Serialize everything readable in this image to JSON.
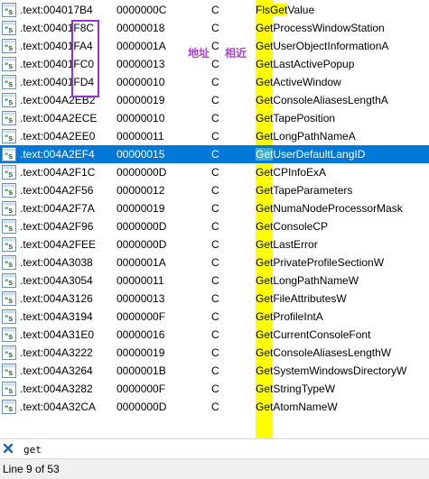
{
  "annotations": {
    "address_label": "地址",
    "similar_label": "相近",
    "box_color": "#9b30d9"
  },
  "colors": {
    "selection": "#0078d7",
    "highlight": "#ffff00",
    "selected_highlight": "#3fb0d0"
  },
  "rows": [
    {
      "address": ".text:004017B4",
      "length": "0000000C",
      "type": "C",
      "pre": "Fls",
      "match": "Get",
      "post": "Value"
    },
    {
      "address": ".text:00401F8C",
      "length": "00000018",
      "type": "C",
      "pre": "",
      "match": "Get",
      "post": "ProcessWindowStation"
    },
    {
      "address": ".text:00401FA4",
      "length": "0000001A",
      "type": "C",
      "pre": "",
      "match": "Get",
      "post": "UserObjectInformationA"
    },
    {
      "address": ".text:00401FC0",
      "length": "00000013",
      "type": "C",
      "pre": "",
      "match": "Get",
      "post": "LastActivePopup"
    },
    {
      "address": ".text:00401FD4",
      "length": "00000010",
      "type": "C",
      "pre": "",
      "match": "Get",
      "post": "ActiveWindow"
    },
    {
      "address": ".text:004A2EB2",
      "length": "00000019",
      "type": "C",
      "pre": "",
      "match": "Get",
      "post": "ConsoleAliasesLengthA"
    },
    {
      "address": ".text:004A2ECE",
      "length": "00000010",
      "type": "C",
      "pre": "",
      "match": "Get",
      "post": "TapePosition"
    },
    {
      "address": ".text:004A2EE0",
      "length": "00000011",
      "type": "C",
      "pre": "",
      "match": "Get",
      "post": "LongPathNameA"
    },
    {
      "address": ".text:004A2EF4",
      "length": "00000015",
      "type": "C",
      "pre": "",
      "match": "Get",
      "post": "UserDefaultLangID",
      "selected": true
    },
    {
      "address": ".text:004A2F1C",
      "length": "0000000D",
      "type": "C",
      "pre": "",
      "match": "Get",
      "post": "CPInfoExA"
    },
    {
      "address": ".text:004A2F56",
      "length": "00000012",
      "type": "C",
      "pre": "",
      "match": "Get",
      "post": "TapeParameters"
    },
    {
      "address": ".text:004A2F7A",
      "length": "00000019",
      "type": "C",
      "pre": "",
      "match": "Get",
      "post": "NumaNodeProcessorMask"
    },
    {
      "address": ".text:004A2F96",
      "length": "0000000D",
      "type": "C",
      "pre": "",
      "match": "Get",
      "post": "ConsoleCP"
    },
    {
      "address": ".text:004A2FEE",
      "length": "0000000D",
      "type": "C",
      "pre": "",
      "match": "Get",
      "post": "LastError"
    },
    {
      "address": ".text:004A3038",
      "length": "0000001A",
      "type": "C",
      "pre": "",
      "match": "Get",
      "post": "PrivateProfileSectionW"
    },
    {
      "address": ".text:004A3054",
      "length": "00000011",
      "type": "C",
      "pre": "",
      "match": "Get",
      "post": "LongPathNameW"
    },
    {
      "address": ".text:004A3126",
      "length": "00000013",
      "type": "C",
      "pre": "",
      "match": "Get",
      "post": "FileAttributesW"
    },
    {
      "address": ".text:004A3194",
      "length": "0000000F",
      "type": "C",
      "pre": "",
      "match": "Get",
      "post": "ProfileIntA"
    },
    {
      "address": ".text:004A31E0",
      "length": "00000016",
      "type": "C",
      "pre": "",
      "match": "Get",
      "post": "CurrentConsoleFont"
    },
    {
      "address": ".text:004A3222",
      "length": "00000019",
      "type": "C",
      "pre": "",
      "match": "Get",
      "post": "ConsoleAliasesLengthW"
    },
    {
      "address": ".text:004A3264",
      "length": "0000001B",
      "type": "C",
      "pre": "",
      "match": "Get",
      "post": "SystemWindowsDirectoryW"
    },
    {
      "address": ".text:004A3282",
      "length": "0000000F",
      "type": "C",
      "pre": "",
      "match": "Get",
      "post": "StringTypeW"
    },
    {
      "address": ".text:004A32CA",
      "length": "0000000D",
      "type": "C",
      "pre": "",
      "match": "Get",
      "post": "AtomNameW"
    }
  ],
  "search": {
    "value": "get",
    "close_icon": "close-x-icon"
  },
  "status": {
    "text": "Line 9 of 53"
  }
}
